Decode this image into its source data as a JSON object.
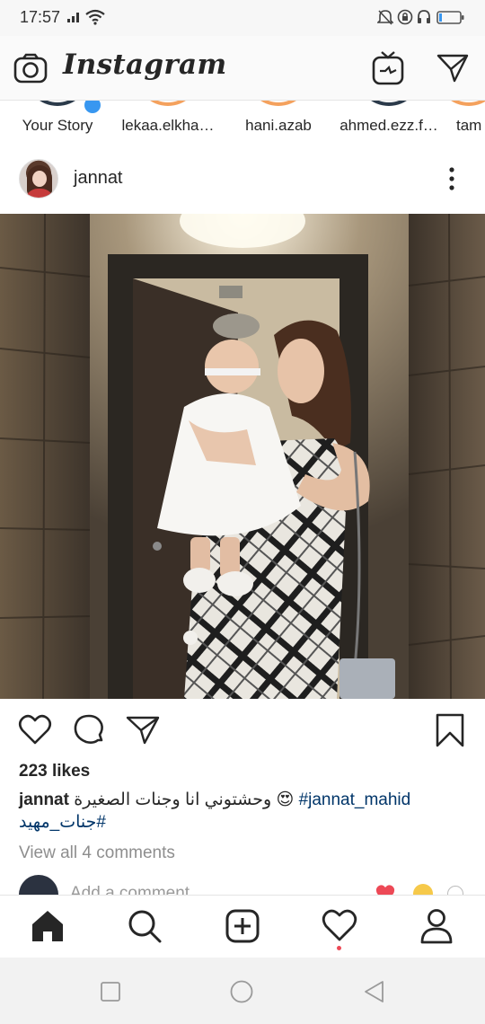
{
  "status_bar": {
    "time": "17:57",
    "icons": [
      "signal-icon",
      "wifi-icon",
      "alarm-off-icon",
      "lock-rotation-icon",
      "headphones-icon",
      "battery-icon"
    ]
  },
  "header": {
    "title": "Instagram",
    "left_icon": "camera-icon",
    "right_icons": [
      "igtv-icon",
      "direct-message-icon"
    ]
  },
  "stories": [
    {
      "label": "Your Story",
      "own": true
    },
    {
      "label": "lekaa.elkha…",
      "seen": false
    },
    {
      "label": "hani.azab",
      "seen": false
    },
    {
      "label": "ahmed.ezz.f…",
      "seen": true
    },
    {
      "label": "tam",
      "seen": false
    }
  ],
  "post": {
    "username": "jannat",
    "likes": "223 likes",
    "caption_user": "jannat",
    "caption_text": "وحشتوني انا وجنات الصغيرة",
    "caption_emoji": "😍",
    "caption_hashtag": "#jannat_mahid",
    "caption_hashtag_2": "#جنات_مهيد",
    "view_comments": "View all 4 comments",
    "add_comment_placeholder": "Add a comment...",
    "quick_reactions": [
      "❤️",
      "😂"
    ]
  },
  "bottom_nav": {
    "items": [
      "home-icon",
      "search-icon",
      "new-post-icon",
      "activity-icon",
      "profile-icon"
    ],
    "activity_notification": true
  },
  "system_nav": [
    "recent-apps-icon",
    "home-circle-icon",
    "back-icon"
  ],
  "colors": {
    "text": "#262626",
    "secondary_text": "#8e8e8e",
    "hashtag": "#003569",
    "story_ring": "#f4a15d",
    "notification_dot": "#ed4956",
    "heart_red": "#ed4956"
  }
}
